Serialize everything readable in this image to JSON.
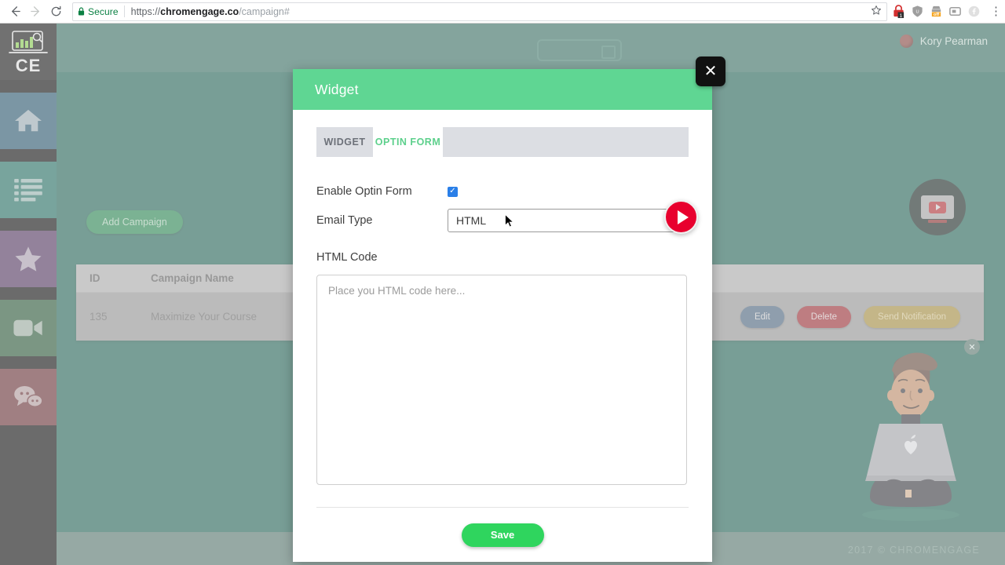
{
  "browser": {
    "back_icon": "back-arrow-icon",
    "forward_icon": "forward-arrow-icon",
    "reload_icon": "reload-icon",
    "lock_icon": "lock-icon",
    "secure_label": "Secure",
    "url_scheme": "https://",
    "url_domain": "chromengage.co",
    "url_path": "/campaign#",
    "star_icon": "bookmark-star-icon",
    "extensions": [
      {
        "name": "lastpass-extension-icon",
        "badge": "1"
      },
      {
        "name": "shield-extension-icon",
        "badge": ""
      },
      {
        "name": "adblock-off-extension-icon",
        "badge": "off"
      },
      {
        "name": "pocket-extension-icon",
        "badge": ""
      },
      {
        "name": "facebook-extension-icon",
        "badge": ""
      }
    ],
    "menu_icon": "three-dots-menu-icon"
  },
  "sidebar": {
    "logo_text": "CE",
    "logo_icon": "laptop-analytics-icon",
    "items": [
      {
        "name": "home",
        "icon": "home-icon"
      },
      {
        "name": "campaigns",
        "icon": "list-icon"
      },
      {
        "name": "favorites",
        "icon": "star-icon"
      },
      {
        "name": "videos",
        "icon": "video-camera-icon"
      },
      {
        "name": "chat",
        "icon": "chat-bubbles-icon"
      }
    ]
  },
  "topbar": {
    "user_name": "Kory Pearman",
    "avatar_icon": "user-avatar"
  },
  "main": {
    "add_campaign_label": "Add Campaign",
    "table": {
      "columns": [
        "ID",
        "Campaign Name"
      ],
      "rows": [
        {
          "id": "135",
          "campaign_name": "Maximize Your Course",
          "actions": [
            "Edit",
            "Delete",
            "Send Notification"
          ]
        }
      ]
    },
    "youtube_icon": "youtube-tutorial-icon",
    "illustration_close_icon": "close-icon",
    "illustration": "man-with-laptop-illustration"
  },
  "footer": {
    "copyright": "2017 © CHROMENGAGE"
  },
  "modal": {
    "title": "Widget",
    "close_icon": "close-x-icon",
    "play_badge_icon": "play-icon",
    "tabs": [
      {
        "label": "WIDGET",
        "active": false
      },
      {
        "label": "OPTIN FORM",
        "active": true
      }
    ],
    "form": {
      "enable_optin_label": "Enable Optin Form",
      "enable_optin_checked": true,
      "checkbox_glyph": "✓",
      "email_type_label": "Email Type",
      "email_type_value": "HTML",
      "html_code_label": "HTML Code",
      "html_code_value": "",
      "html_code_placeholder": "Place you HTML code here..."
    },
    "save_label": "Save"
  },
  "colors": {
    "modal_header_green": "#5fd693",
    "app_background_teal": "#17584a",
    "save_button_green": "#2fd55e",
    "play_badge_red": "#e8002e",
    "tab_active_green": "#5dd08c",
    "checkbox_blue": "#2a7fe8",
    "secure_green": "#0b8043"
  }
}
